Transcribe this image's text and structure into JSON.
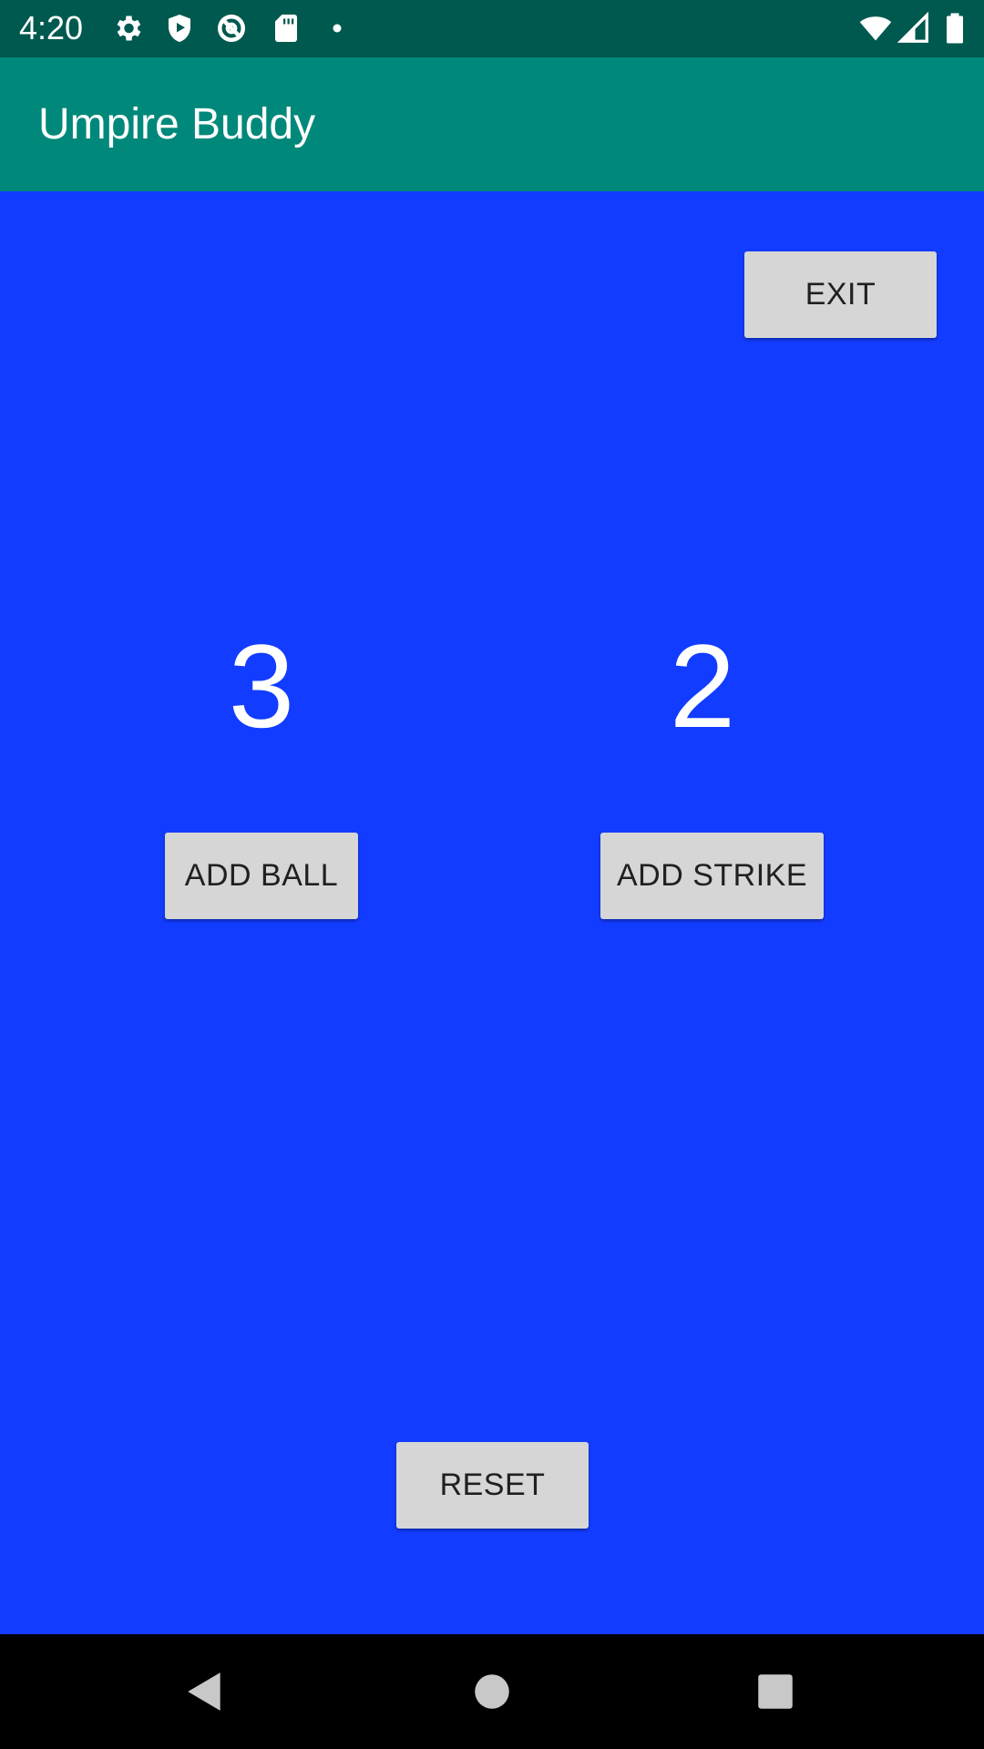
{
  "status_bar": {
    "time": "4:20",
    "left_icons": [
      "settings-icon",
      "shield-play-icon",
      "no-sync-icon",
      "sd-card-icon",
      "notification-dot-icon"
    ],
    "right_icons": [
      "wifi-icon",
      "signal-icon",
      "battery-icon"
    ]
  },
  "app_bar": {
    "title": "Umpire Buddy",
    "color": "#00887a"
  },
  "main": {
    "background": "#123cff",
    "exit_label": "EXIT",
    "ball_count": "3",
    "strike_count": "2",
    "add_ball_label": "ADD BALL",
    "add_strike_label": "ADD STRIKE",
    "reset_label": "RESET"
  },
  "nav_bar": {
    "icons": [
      "back-icon",
      "home-icon",
      "recents-icon"
    ]
  }
}
